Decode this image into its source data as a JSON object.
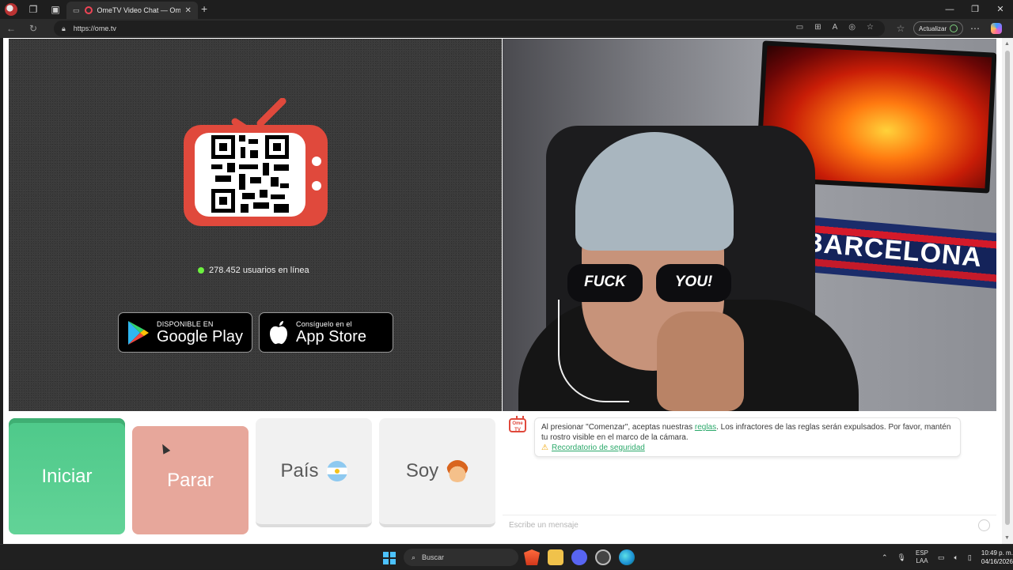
{
  "browser": {
    "tab_title": "OmeTV Video Chat — Omeg",
    "url": "https://ome.tv",
    "update_button": "Actualizar"
  },
  "left_panel": {
    "online_count": "278.452 usuarios en línea",
    "google_play_small": "DISPONIBLE EN",
    "google_play_big": "Google Play",
    "app_store_small": "Consíguelo en el",
    "app_store_big": "App Store"
  },
  "right_video": {
    "glasses_left": "FUCK",
    "glasses_right": "YOU!",
    "banner_text": "BARCELONA"
  },
  "controls": {
    "start": "Iniciar",
    "stop": "Parar",
    "country": "País",
    "me": "Soy"
  },
  "chat": {
    "logo_text": "Ome TV",
    "notice_prefix": "Al presionar \"Comenzar\", aceptas nuestras ",
    "notice_link": "reglas",
    "notice_suffix": ". Los infractores de las reglas serán expulsados. Por favor, mantén tu rostro visible en el marco de la cámara.",
    "safety_link": "Recordatorio de seguridad",
    "input_placeholder": "Escribe un mensaje"
  },
  "taskbar": {
    "search_label": "Buscar",
    "lang_top": "ESP",
    "lang_bottom": "LAA",
    "time": "10:49 p. m.",
    "date": "04/16/2026"
  },
  "colors": {
    "start_green": "#4ec98a",
    "stop_salmon": "#e7a79b",
    "brand_red": "#e0493c",
    "link_green": "#2ca96b",
    "online_dot": "#6cf23f"
  }
}
